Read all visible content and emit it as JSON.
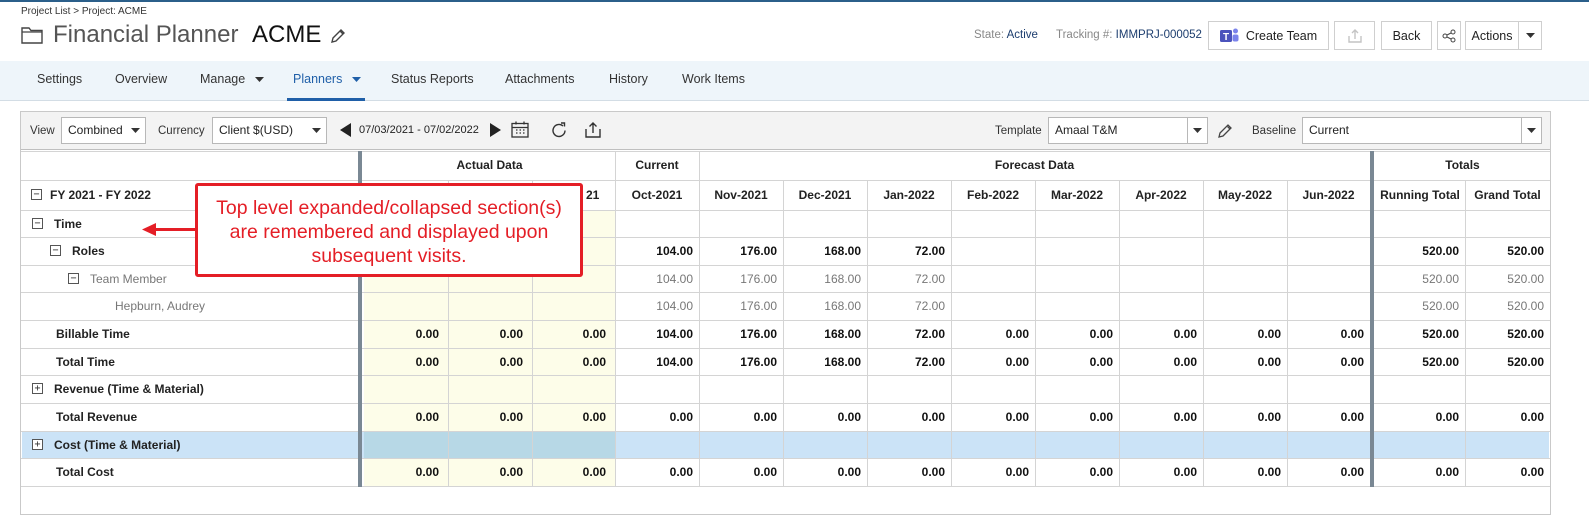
{
  "breadcrumb": "Project List > Project: ACME",
  "page_type": "Financial Planner",
  "project_name": "ACME",
  "state_label": "State:",
  "state_value": "Active",
  "tracking_label": "Tracking #:",
  "tracking_value": "IMMPRJ-000052",
  "buttons": {
    "create_team": "Create Team",
    "back": "Back",
    "actions": "Actions"
  },
  "nav": [
    "Settings",
    "Overview",
    "Manage",
    "Planners",
    "Status Reports",
    "Attachments",
    "History",
    "Work Items"
  ],
  "toolbar": {
    "view_label": "View",
    "view_value": "Combined",
    "currency_label": "Currency",
    "currency_value": "Client $(USD)",
    "date_range": "07/03/2021 - 07/02/2022",
    "template_label": "Template",
    "template_value": "Amaal T&M",
    "baseline_label": "Baseline",
    "baseline_value": "Current"
  },
  "grid": {
    "group_headers": {
      "actual": "Actual Data",
      "current": "Current",
      "forecast": "Forecast Data",
      "totals": "Totals"
    },
    "fy_label": "FY 2021 - FY 2022",
    "partial_month": "21",
    "months": [
      "Oct-2021",
      "Nov-2021",
      "Dec-2021",
      "Jan-2022",
      "Feb-2022",
      "Mar-2022",
      "Apr-2022",
      "May-2022",
      "Jun-2022"
    ],
    "total_headers": [
      "Running Total",
      "Grand Total"
    ],
    "rows": [
      {
        "label": "Time",
        "expander": "−",
        "actual": [
          "",
          "",
          ""
        ],
        "values": [
          "",
          "",
          "",
          "",
          "",
          "",
          "",
          "",
          ""
        ],
        "totals": [
          "",
          ""
        ]
      },
      {
        "label": "Roles",
        "expander": "−",
        "actual": [
          "",
          "",
          ""
        ],
        "values": [
          "104.00",
          "176.00",
          "168.00",
          "72.00",
          "",
          "",
          "",
          "",
          ""
        ],
        "totals": [
          "520.00",
          "520.00"
        ]
      },
      {
        "label": "Team Member",
        "expander": "−",
        "light": true,
        "actual": [
          "",
          "",
          ""
        ],
        "values": [
          "104.00",
          "176.00",
          "168.00",
          "72.00",
          "",
          "",
          "",
          "",
          ""
        ],
        "totals": [
          "520.00",
          "520.00"
        ]
      },
      {
        "label": "Hepburn, Audrey",
        "expander": "",
        "light": true,
        "actual": [
          "",
          "",
          ""
        ],
        "values": [
          "104.00",
          "176.00",
          "168.00",
          "72.00",
          "",
          "",
          "",
          "",
          ""
        ],
        "totals": [
          "520.00",
          "520.00"
        ]
      },
      {
        "label": "Billable Time",
        "expander": "",
        "actual": [
          "0.00",
          "0.00",
          "0.00"
        ],
        "values": [
          "104.00",
          "176.00",
          "168.00",
          "72.00",
          "0.00",
          "0.00",
          "0.00",
          "0.00",
          "0.00"
        ],
        "totals": [
          "520.00",
          "520.00"
        ]
      },
      {
        "label": "Total Time",
        "expander": "",
        "actual": [
          "0.00",
          "0.00",
          "0.00"
        ],
        "values": [
          "104.00",
          "176.00",
          "168.00",
          "72.00",
          "0.00",
          "0.00",
          "0.00",
          "0.00",
          "0.00"
        ],
        "totals": [
          "520.00",
          "520.00"
        ]
      },
      {
        "label": "Revenue (Time & Material)",
        "expander": "+",
        "actual": [
          "",
          "",
          ""
        ],
        "values": [
          "",
          "",
          "",
          "",
          "",
          "",
          "",
          "",
          ""
        ],
        "totals": [
          "",
          ""
        ]
      },
      {
        "label": "Total Revenue",
        "expander": "",
        "actual": [
          "0.00",
          "0.00",
          "0.00"
        ],
        "values": [
          "0.00",
          "0.00",
          "0.00",
          "0.00",
          "0.00",
          "0.00",
          "0.00",
          "0.00",
          "0.00"
        ],
        "totals": [
          "0.00",
          "0.00"
        ]
      },
      {
        "label": "Cost (Time & Material)",
        "expander": "+",
        "actual": [
          "",
          "",
          ""
        ],
        "values": [
          "",
          "",
          "",
          "",
          "",
          "",
          "",
          "",
          ""
        ],
        "totals": [
          "",
          ""
        ]
      },
      {
        "label": "Total Cost",
        "expander": "",
        "actual": [
          "0.00",
          "0.00",
          "0.00"
        ],
        "values": [
          "0.00",
          "0.00",
          "0.00",
          "0.00",
          "0.00",
          "0.00",
          "0.00",
          "0.00",
          "0.00"
        ],
        "totals": [
          "0.00",
          "0.00"
        ]
      }
    ]
  },
  "callout": {
    "line1": "Top level expanded/collapsed section(s)",
    "line2": "are remembered and displayed upon",
    "line3": "subsequent visits."
  },
  "colors": {
    "accent": "#1f5fa8",
    "callout": "#e41e26",
    "selected_row": "#cbe3f7",
    "actual_bg": "#fdfde9"
  }
}
